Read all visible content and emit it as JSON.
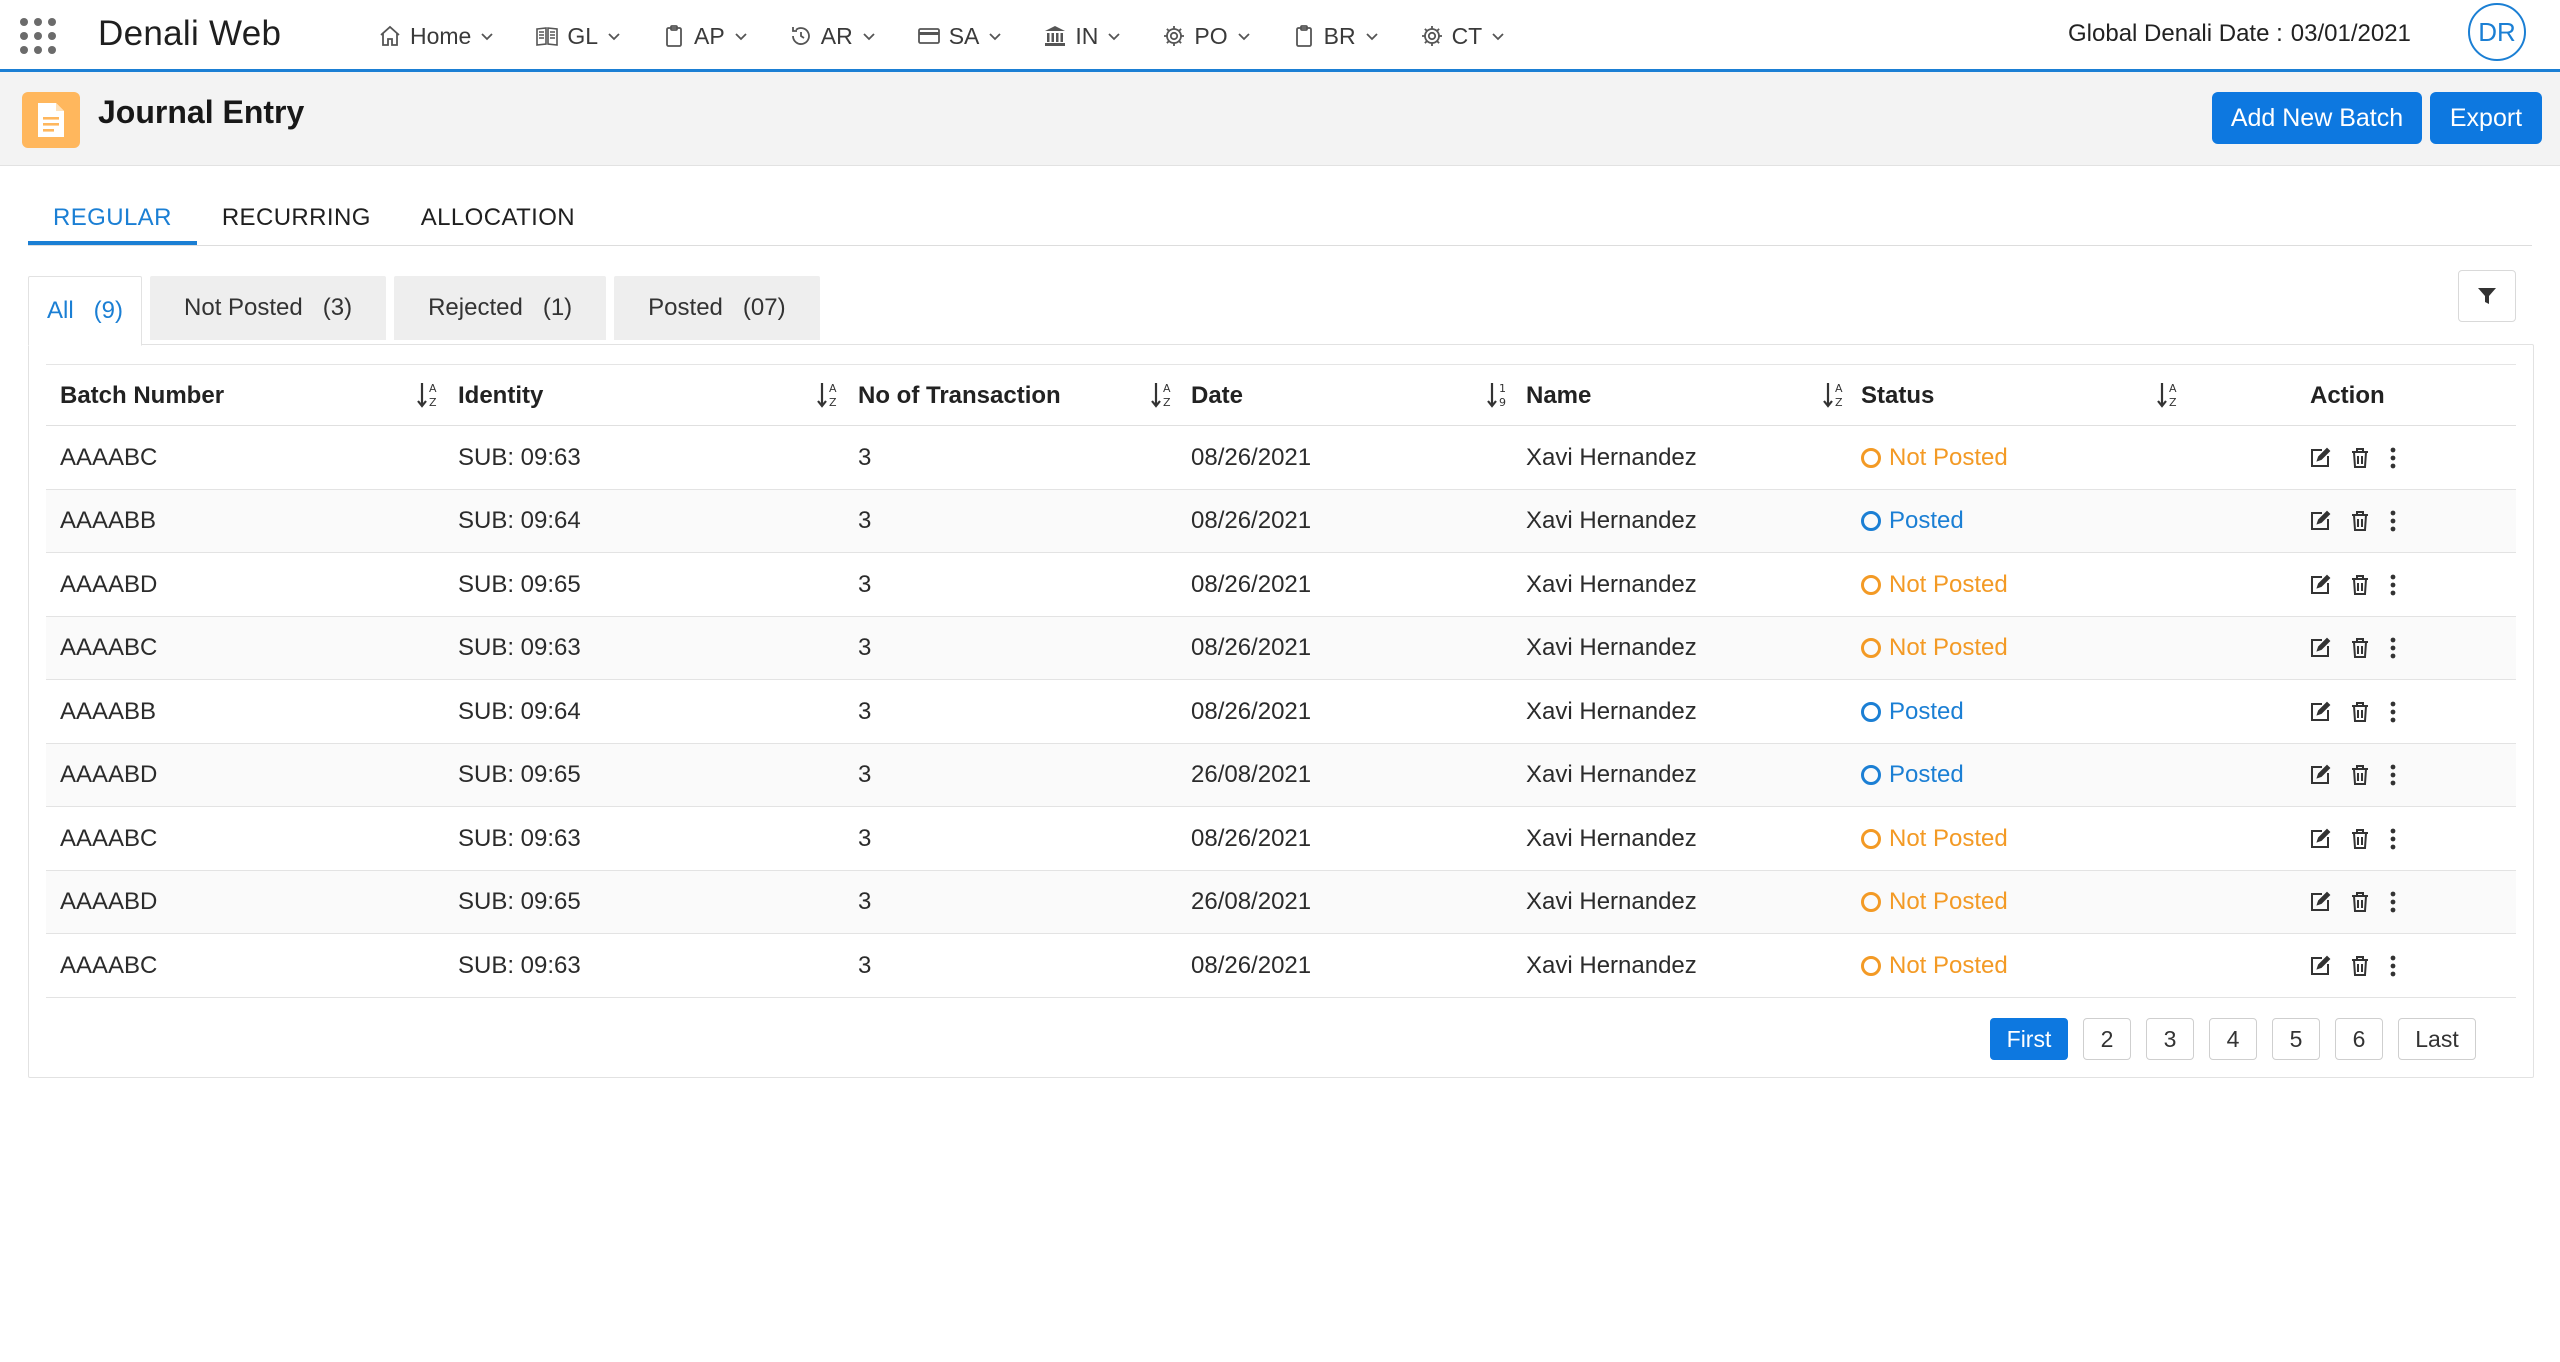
{
  "app": {
    "name": "Denali Web"
  },
  "nav": {
    "items": [
      {
        "label": "Home",
        "icon": "home-icon"
      },
      {
        "label": "GL",
        "icon": "book-icon"
      },
      {
        "label": "AP",
        "icon": "clipboard-icon"
      },
      {
        "label": "AR",
        "icon": "refresh-clock-icon"
      },
      {
        "label": "SA",
        "icon": "credit-card-icon"
      },
      {
        "label": "IN",
        "icon": "bank-icon"
      },
      {
        "label": "PO",
        "icon": "gear-icon"
      },
      {
        "label": "BR",
        "icon": "clipboard-icon"
      },
      {
        "label": "CT",
        "icon": "gear-icon"
      }
    ],
    "global_date_label": "Global Denali Date :",
    "global_date_value": "03/01/2021",
    "avatar_initials": "DR"
  },
  "page": {
    "title": "Journal Entry",
    "add_button": "Add New Batch",
    "export_button": "Export"
  },
  "main_tabs": [
    {
      "label": "REGULAR",
      "active": true
    },
    {
      "label": "RECURRING",
      "active": false
    },
    {
      "label": "ALLOCATION",
      "active": false
    }
  ],
  "sub_tabs": [
    {
      "label": "All",
      "count": "(9)",
      "active": true
    },
    {
      "label": "Not Posted",
      "count": "(3)",
      "active": false
    },
    {
      "label": "Rejected",
      "count": "(1)",
      "active": false
    },
    {
      "label": "Posted",
      "count": "(07)",
      "active": false
    }
  ],
  "table": {
    "columns": [
      "Batch Number",
      "Identity",
      "No of Transaction",
      "Date",
      "Name",
      "Status",
      "Action"
    ],
    "rows": [
      {
        "batch": "AAAABC",
        "identity": "SUB: 09:63",
        "transactions": "3",
        "date": "08/26/2021",
        "name": "Xavi Hernandez",
        "status": "Not Posted"
      },
      {
        "batch": "AAAABB",
        "identity": "SUB: 09:64",
        "transactions": "3",
        "date": "08/26/2021",
        "name": "Xavi Hernandez",
        "status": "Posted"
      },
      {
        "batch": "AAAABD",
        "identity": "SUB: 09:65",
        "transactions": "3",
        "date": "08/26/2021",
        "name": "Xavi Hernandez",
        "status": "Not Posted"
      },
      {
        "batch": "AAAABC",
        "identity": "SUB: 09:63",
        "transactions": "3",
        "date": "08/26/2021",
        "name": "Xavi Hernandez",
        "status": "Not Posted"
      },
      {
        "batch": "AAAABB",
        "identity": "SUB: 09:64",
        "transactions": "3",
        "date": "08/26/2021",
        "name": "Xavi Hernandez",
        "status": "Posted"
      },
      {
        "batch": "AAAABD",
        "identity": "SUB: 09:65",
        "transactions": "3",
        "date": "26/08/2021",
        "name": "Xavi Hernandez",
        "status": "Posted"
      },
      {
        "batch": "AAAABC",
        "identity": "SUB: 09:63",
        "transactions": "3",
        "date": "08/26/2021",
        "name": "Xavi Hernandez",
        "status": "Not Posted"
      },
      {
        "batch": "AAAABD",
        "identity": "SUB: 09:65",
        "transactions": "3",
        "date": "26/08/2021",
        "name": "Xavi Hernandez",
        "status": "Not Posted"
      },
      {
        "batch": "AAAABC",
        "identity": "SUB: 09:63",
        "transactions": "3",
        "date": "08/26/2021",
        "name": "Xavi Hernandez",
        "status": "Not Posted"
      }
    ]
  },
  "pagination": {
    "first": "First",
    "pages": [
      "2",
      "3",
      "4",
      "5",
      "6"
    ],
    "last": "Last"
  },
  "colors": {
    "accent": "#1b7fd4",
    "button": "#0d78e0",
    "not_posted": "#f39a25",
    "posted": "#1b7fd4",
    "page_icon": "#ffb75d"
  }
}
